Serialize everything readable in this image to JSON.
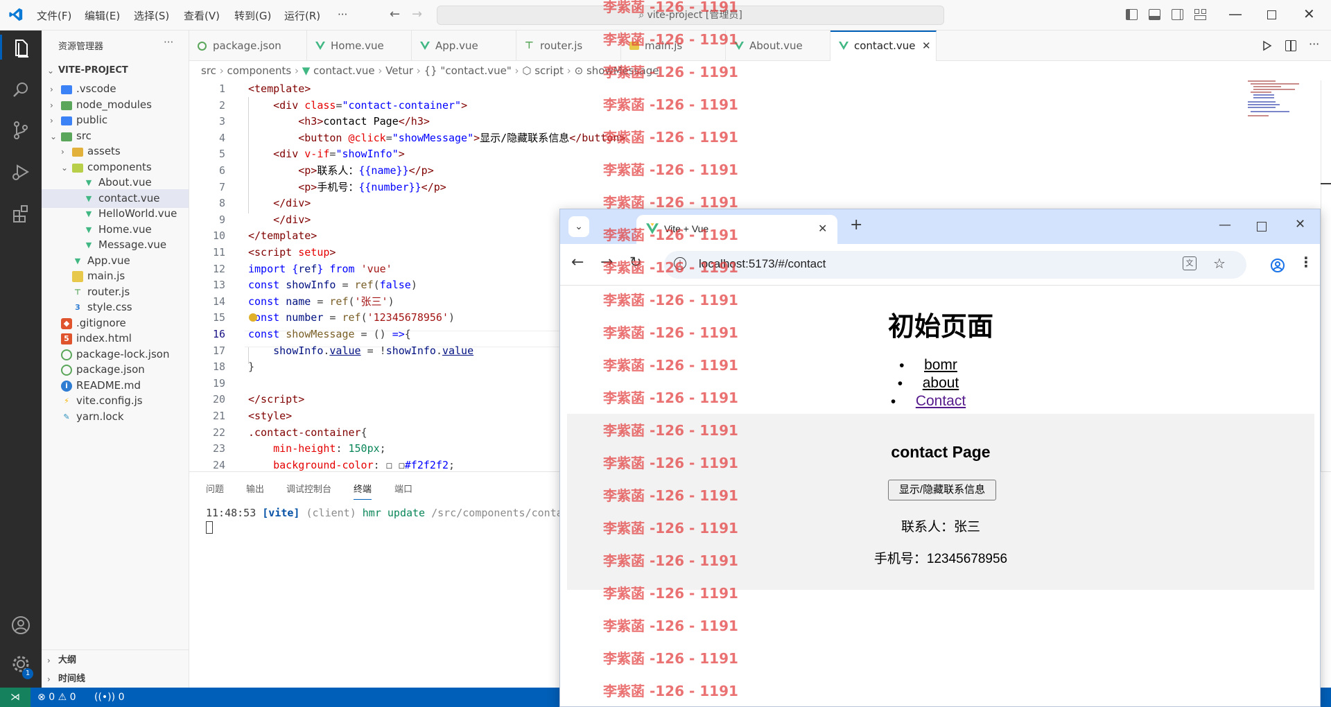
{
  "titlebar": {
    "menu": [
      "文件(F)",
      "编辑(E)",
      "选择(S)",
      "查看(V)",
      "转到(G)",
      "运行(R)",
      "···"
    ],
    "search_text": "vite-project [管理员]"
  },
  "sidebar": {
    "title": "资源管理器",
    "more": "···",
    "project": "VITE-PROJECT",
    "items": [
      {
        "label": ".vscode",
        "kind": "folder",
        "icon_color": "#3b82f6"
      },
      {
        "label": "node_modules",
        "kind": "folder",
        "icon_color": "#5aa65a"
      },
      {
        "label": "public",
        "kind": "folder",
        "icon_color": "#3b82f6"
      },
      {
        "label": "src",
        "kind": "folder-open",
        "icon_color": "#5aa65a"
      },
      {
        "label": "assets",
        "kind": "folder",
        "icon_color": "#e2b13c"
      },
      {
        "label": "components",
        "kind": "folder-open",
        "icon_color": "#b8cf4a"
      },
      {
        "label": "About.vue",
        "kind": "vue"
      },
      {
        "label": "contact.vue",
        "kind": "vue"
      },
      {
        "label": "HelloWorld.vue",
        "kind": "vue"
      },
      {
        "label": "Home.vue",
        "kind": "vue"
      },
      {
        "label": "Message.vue",
        "kind": "vue"
      },
      {
        "label": "App.vue",
        "kind": "vue"
      },
      {
        "label": "main.js",
        "kind": "js"
      },
      {
        "label": "router.js",
        "kind": "router"
      },
      {
        "label": "style.css",
        "kind": "css"
      },
      {
        "label": ".gitignore",
        "kind": "git"
      },
      {
        "label": "index.html",
        "kind": "html"
      },
      {
        "label": "package-lock.json",
        "kind": "json"
      },
      {
        "label": "package.json",
        "kind": "json"
      },
      {
        "label": "README.md",
        "kind": "info"
      },
      {
        "label": "vite.config.js",
        "kind": "vite"
      },
      {
        "label": "yarn.lock",
        "kind": "yarn"
      }
    ],
    "outline": "大纲",
    "timeline": "时间线"
  },
  "tabs": [
    {
      "label": "package.json"
    },
    {
      "label": "Home.vue"
    },
    {
      "label": "App.vue"
    },
    {
      "label": "router.js"
    },
    {
      "label": "main.js"
    },
    {
      "label": "About.vue"
    },
    {
      "label": "contact.vue",
      "active": true
    }
  ],
  "breadcrumb": [
    "src",
    "components",
    "contact.vue",
    "Vetur",
    "{} \"contact.vue\"",
    "script",
    "showMessage"
  ],
  "code": [
    {
      "n": "1",
      "html": "<span class='t-tag'>&lt;template&gt;</span>"
    },
    {
      "n": "2",
      "html": "    <span class='t-tag'>&lt;div</span> <span class='t-attr'>class</span>=<span class='t-kw'>\"contact-container\"</span><span class='t-tag'>&gt;</span>"
    },
    {
      "n": "3",
      "html": "        <span class='t-tag'>&lt;h3&gt;</span><span class='t-txt'>contact Page</span><span class='t-tag'>&lt;/h3&gt;</span>"
    },
    {
      "n": "4",
      "html": "        <span class='t-tag'>&lt;button</span> <span class='t-attr'>@click</span>=<span class='t-kw'>\"showMessage\"</span><span class='t-tag'>&gt;</span><span class='t-txt'>显示/隐藏联系信息</span><span class='t-tag'>&lt;/button&gt;</span>"
    },
    {
      "n": "5",
      "html": "    <span class='t-tag'>&lt;div</span> <span class='t-attr'>v-if</span>=<span class='t-kw'>\"showInfo\"</span><span class='t-tag'>&gt;</span>"
    },
    {
      "n": "6",
      "html": "        <span class='t-tag'>&lt;p&gt;</span><span class='t-txt'>联系人：</span><span class='t-kw'>{{name}}</span><span class='t-tag'>&lt;/p&gt;</span>"
    },
    {
      "n": "7",
      "html": "        <span class='t-tag'>&lt;p&gt;</span><span class='t-txt'>手机号：</span><span class='t-kw'>{{number}}</span><span class='t-tag'>&lt;/p&gt;</span>"
    },
    {
      "n": "8",
      "html": "    <span class='t-tag'>&lt;/div&gt;</span>"
    },
    {
      "n": "9",
      "html": "    <span class='t-tag'>&lt;/div&gt;</span>"
    },
    {
      "n": "10",
      "html": "<span class='t-tag'>&lt;/template&gt;</span>"
    },
    {
      "n": "11",
      "html": "<span class='t-tag'>&lt;script</span> <span class='t-attr'>setup</span><span class='t-tag'>&gt;</span>"
    },
    {
      "n": "12",
      "html": "<span class='t-kw'>import</span> <span class='t-kw'>{</span><span class='t-var'>ref</span><span class='t-kw'>}</span> <span class='t-kw'>from</span> <span class='t-str'>'vue'</span>"
    },
    {
      "n": "13",
      "html": "<span class='t-kw'>const</span> <span class='t-var'>showInfo</span> = <span class='t-fn'>ref</span>(<span class='t-kw'>false</span>)"
    },
    {
      "n": "14",
      "html": "<span class='t-kw'>const</span> <span class='t-var'>name</span> = <span class='t-fn'>ref</span>(<span class='t-str'>'张三'</span>)"
    },
    {
      "n": "15",
      "html": "<span class='t-kw'>const</span> <span class='t-var'>number</span> = <span class='t-fn'>ref</span>(<span class='t-str'>'12345678956'</span>)"
    },
    {
      "n": "16",
      "html": "<span class='t-kw'>const</span> <span class='t-fn'>showMessage</span> = () <span class='t-kw'>=&gt;</span>{",
      "current": true
    },
    {
      "n": "17",
      "html": "    <span class='t-var'>showInfo</span>.<span class='t-var' style='text-decoration:underline'>value</span> = !<span class='t-var'>showInfo</span>.<span class='t-var' style='text-decoration:underline'>value</span>"
    },
    {
      "n": "18",
      "html": "}"
    },
    {
      "n": "19",
      "html": ""
    },
    {
      "n": "20",
      "html": "<span class='t-tag'>&lt;/script&gt;</span>"
    },
    {
      "n": "21",
      "html": "<span class='t-tag'>&lt;style&gt;</span>"
    },
    {
      "n": "22",
      "html": "<span class='t-css'>.contact-container</span>{"
    },
    {
      "n": "23",
      "html": "    <span class='t-attr'>min-height</span>: <span class='t-num'>150px</span>;"
    },
    {
      "n": "24",
      "html": "    <span class='t-attr'>background-color</span>: <span class='t-txt'>☐ ☐</span><span class='t-kw'>#f2f2f2</span>;"
    }
  ],
  "panel": {
    "tabs": [
      "问题",
      "输出",
      "调试控制台",
      "终端",
      "端口"
    ],
    "active_tab": "终端",
    "terminal_time": "11:48:53",
    "terminal_tag": "[vite]",
    "terminal_client": "(client)",
    "terminal_msg": "hmr update",
    "terminal_path": "/src/components/conta"
  },
  "status": {
    "errors": "0",
    "warnings": "0",
    "ports": "0",
    "settings_badge": "1"
  },
  "browser": {
    "tab_title": "Vite + Vue",
    "new_tab": "+",
    "url": "localhost:5173/#/contact",
    "page": {
      "heading": "初始页面",
      "nav": [
        "bomr",
        "about",
        "Contact"
      ],
      "contact_title": "contact Page",
      "button_label": "显示/隐藏联系信息",
      "contact_person": "联系人：张三",
      "phone": "手机号：12345678956"
    }
  },
  "watermark": "李紫菡 -126 - 1191",
  "colors": {
    "accent": "#005fb8",
    "activity_bar": "#2c2c2c",
    "vue_green": "#41b883",
    "watermark": "#e23c3c",
    "contact_bg": "#f2f2f2",
    "browser_tabstrip": "#d3e3fd"
  }
}
